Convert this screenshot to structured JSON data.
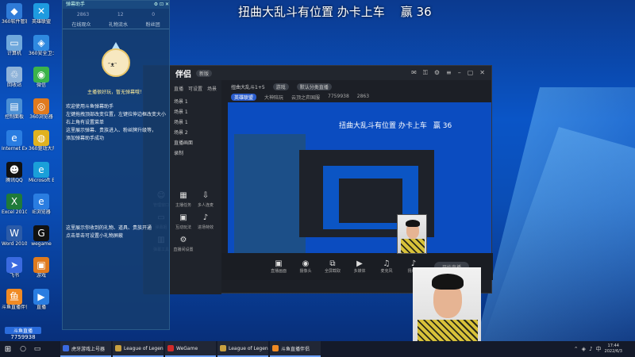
{
  "banner": {
    "text": "扭曲大乱斗有位置  办卡上车",
    "score": "赢 36"
  },
  "desktop_icons": [
    {
      "label": "360软件管家",
      "color": "#2f7bd8",
      "glyph": "◆"
    },
    {
      "label": "英雄联盟",
      "color": "#1e9be0",
      "glyph": "✕"
    },
    {
      "label": "计算机",
      "color": "#6fa8dc",
      "glyph": "▭"
    },
    {
      "label": "360安全卫士",
      "color": "#2f89e0",
      "glyph": "◈"
    },
    {
      "label": "回收站",
      "color": "#8fb3d9",
      "glyph": "♲"
    },
    {
      "label": "微信",
      "color": "#3bb34a",
      "glyph": "◉"
    },
    {
      "label": "控制面板",
      "color": "#4a8fd4",
      "glyph": "▤"
    },
    {
      "label": "360浏览器",
      "color": "#e07a1e",
      "glyph": "◎"
    },
    {
      "label": "Internet Explorer",
      "color": "#2a7de1",
      "glyph": "e"
    },
    {
      "label": "360驱动大师",
      "color": "#e0b21e",
      "glyph": "◍"
    },
    {
      "label": "腾讯QQ",
      "color": "#111111",
      "glyph": "☻"
    },
    {
      "label": "Microsoft Edge",
      "color": "#1a9fd9",
      "glyph": "e"
    },
    {
      "label": "Excel 2010",
      "color": "#1f7a3a",
      "glyph": "X"
    },
    {
      "label": "IE浏览器",
      "color": "#2a7de1",
      "glyph": "e"
    },
    {
      "label": "Word 2010",
      "color": "#2b5ba8",
      "glyph": "W"
    },
    {
      "label": "wegame",
      "color": "#111111",
      "glyph": "G"
    },
    {
      "label": "飞书",
      "color": "#3a6ae0",
      "glyph": "➤"
    },
    {
      "label": "游戏",
      "color": "#e07a1e",
      "glyph": "▣"
    },
    {
      "label": "斗鱼直播伴侣",
      "color": "#f08a24",
      "glyph": "鱼"
    },
    {
      "label": "直播",
      "color": "#2a7de1",
      "glyph": "▶"
    }
  ],
  "panel": {
    "title": "弹幕助手",
    "stats": [
      "2863",
      "12",
      "0"
    ],
    "tabs": [
      "在线观众",
      "礼物流水",
      "粉丝团"
    ],
    "mascot_caption": "主播很好玩，暂无弹幕哦！",
    "tips": [
      "欢迎使用斗鱼弹幕助手",
      "左键拖拽顶部改变位置，左键拉伸边框改变大小",
      "右上角有设置菜单",
      "这里展示弹幕、贵族进入、粉丝牌升级等，",
      "添加弹幕助手成功"
    ],
    "tips2": [
      "这里展示你收到的礼物、道具、贵族开通",
      "点击单击可设置小礼物屏蔽"
    ]
  },
  "app": {
    "logo": "伴侣",
    "version": "新版",
    "nav": [
      "直播",
      "可设置",
      "场景"
    ],
    "scenes": [
      "场景 1",
      "场景 1",
      "场景 1",
      "场景 2",
      "直播画面",
      "录制"
    ],
    "tools": [
      {
        "label": "管理窗口",
        "glyph": "☺"
      },
      {
        "label": "主播任务",
        "glyph": "▦"
      },
      {
        "label": "多人连麦",
        "glyph": "⇩"
      },
      {
        "label": "弹幕姬",
        "glyph": "▭"
      },
      {
        "label": "互动玩法",
        "glyph": "▣"
      },
      {
        "label": "进场特效",
        "glyph": "♪"
      },
      {
        "label": "弹幕工具",
        "glyph": "▥"
      },
      {
        "label": "直播间设置",
        "glyph": "⚙"
      }
    ],
    "room_title": "扭曲大乱斗1+5",
    "room_tag": "游戏",
    "room_chip": "默认分类直播",
    "room_category": "英雄联盟",
    "room_mode": "大神陪玩",
    "room_server": "云顶之弈国服",
    "room_id": "7759938",
    "viewers": "2863",
    "preview_text": "扭曲大乱斗有位置  办卡上车",
    "preview_score": "赢 36",
    "bottom_tools": [
      {
        "label": "直播画面",
        "glyph": "▣"
      },
      {
        "label": "摄像头",
        "glyph": "◉"
      },
      {
        "label": "全屏截取",
        "glyph": "⧉"
      },
      {
        "label": "多媒体",
        "glyph": "▶"
      },
      {
        "label": "麦克风",
        "glyph": "♫"
      },
      {
        "label": "扬声器",
        "glyph": "♪"
      }
    ],
    "go_live": "开始直播"
  },
  "live_id": {
    "badge": "斗鱼直播",
    "number": "7759938"
  },
  "taskbar": {
    "apps": [
      {
        "label": "虎牙游戏上号器",
        "color": "#3a6ae0"
      },
      {
        "label": "League of Legends",
        "color": "#c8a040"
      },
      {
        "label": "WeGame",
        "color": "#d02a2a"
      },
      {
        "label": "League of Legen...",
        "color": "#c8a040"
      },
      {
        "label": "斗鱼直播伴侣",
        "color": "#f08a24"
      }
    ],
    "time": "17:44",
    "date": "2022/6/3"
  }
}
